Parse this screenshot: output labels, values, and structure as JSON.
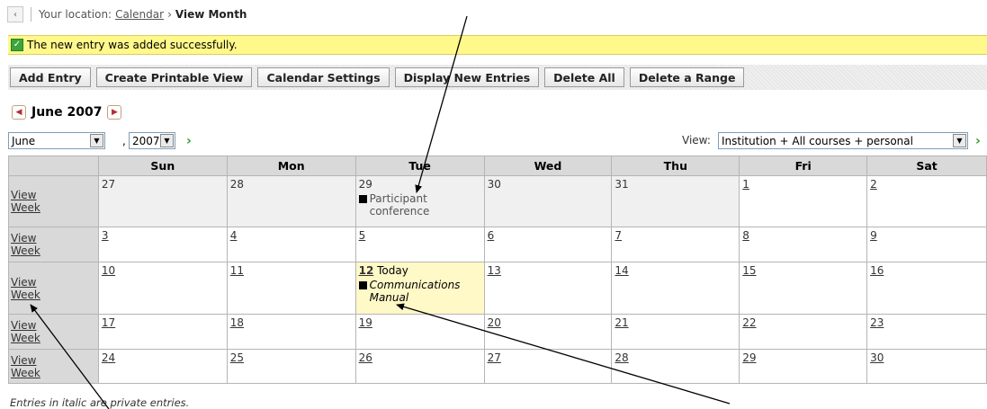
{
  "breadcrumb": {
    "back_icon": "‹",
    "prefix": "Your location:",
    "parent": "Calendar",
    "arrow": "›",
    "current": "View Month"
  },
  "notice": {
    "icon": "✓",
    "text": "The new entry was added successfully."
  },
  "toolbar": {
    "buttons": [
      "Add Entry",
      "Create Printable View",
      "Calendar Settings",
      "Display New Entries",
      "Delete All",
      "Delete a Range"
    ]
  },
  "month_header": {
    "title": "June 2007",
    "prev_icon": "prev-month-icon",
    "next_icon": "next-month-icon"
  },
  "pickers": {
    "month": "June",
    "comma": ",",
    "year": "2007",
    "view_label": "View:",
    "view": "Institution + All courses + personal",
    "arrow_glyph": "▼",
    "go_glyph": "›"
  },
  "calendar": {
    "days": [
      "Sun",
      "Mon",
      "Tue",
      "Wed",
      "Thu",
      "Fri",
      "Sat"
    ],
    "view_week": [
      "View",
      "Week"
    ],
    "today_label": "Today",
    "weeks": [
      [
        "27",
        "28",
        "29",
        "30",
        "31",
        "1",
        "2"
      ],
      [
        "3",
        "4",
        "5",
        "6",
        "7",
        "8",
        "9"
      ],
      [
        "10",
        "11",
        "12",
        "13",
        "14",
        "15",
        "16"
      ],
      [
        "17",
        "18",
        "19",
        "20",
        "21",
        "22",
        "23"
      ],
      [
        "24",
        "25",
        "26",
        "27",
        "28",
        "29",
        "30"
      ]
    ],
    "entries": {
      "participant": "Participant conference",
      "communications": "Communications Manual"
    }
  },
  "footnote": "Entries in italic are private entries.",
  "colors": {
    "notice_bg": "#fff88a",
    "today_bg": "#fff9c7",
    "header_bg": "#d9d9d9",
    "go_green": "#2f9a2f"
  }
}
